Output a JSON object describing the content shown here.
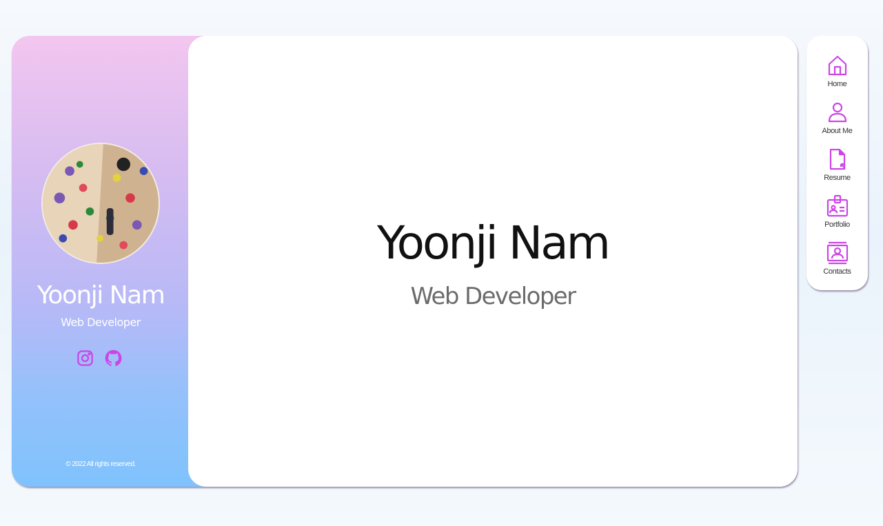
{
  "sidebar": {
    "name": "Yoonji Nam",
    "role": "Web Developer",
    "copyright": "© 2022 All rights reserved.",
    "socials": [
      "instagram-icon",
      "github-icon"
    ]
  },
  "main": {
    "name": "Yoonji Nam",
    "role": "Web Developer"
  },
  "nav": {
    "items": [
      {
        "label": "Home",
        "icon": "home-icon"
      },
      {
        "label": "About Me",
        "icon": "user-icon"
      },
      {
        "label": "Resume",
        "icon": "document-icon"
      },
      {
        "label": "Portfolio",
        "icon": "id-card-icon"
      },
      {
        "label": "Contacts",
        "icon": "contact-card-icon"
      }
    ]
  },
  "colors": {
    "accent": "#cc44e6",
    "sidebar_top": "#f3c6ef",
    "sidebar_bottom": "#7fc2fd"
  }
}
